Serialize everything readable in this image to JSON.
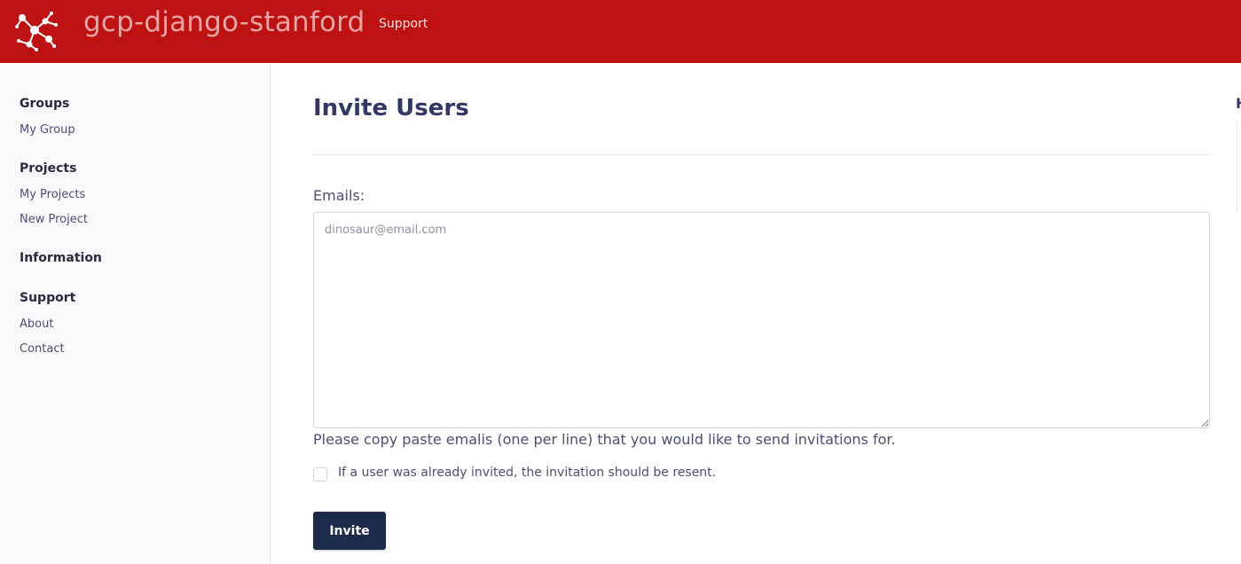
{
  "header": {
    "site_title": "gcp-django-stanford",
    "nav_support": "Support",
    "logo_icon": "network-graph-logo-icon",
    "bar_color": "#bd1112"
  },
  "sidebar": {
    "sections": [
      {
        "heading": "Groups",
        "items": [
          "My Group"
        ]
      },
      {
        "heading": "Projects",
        "items": [
          "My Projects",
          "New Project"
        ]
      },
      {
        "heading": "Information",
        "items": []
      },
      {
        "heading": "Support",
        "items": [
          "About",
          "Contact"
        ]
      }
    ]
  },
  "main": {
    "title": "Invite Users",
    "emails_label": "Emails:",
    "emails_placeholder": "dinosaur@email.com",
    "emails_value": "",
    "help_text": "Please copy paste emalis (one per line) that you would like to send invitations for.",
    "resend_checkbox_label": "If a user was already invited, the invitation should be resent.",
    "resend_checked": false,
    "invite_button": "Invite",
    "button_color": "#1c2a4c"
  },
  "right_panel": {
    "partial_heading": "H"
  }
}
